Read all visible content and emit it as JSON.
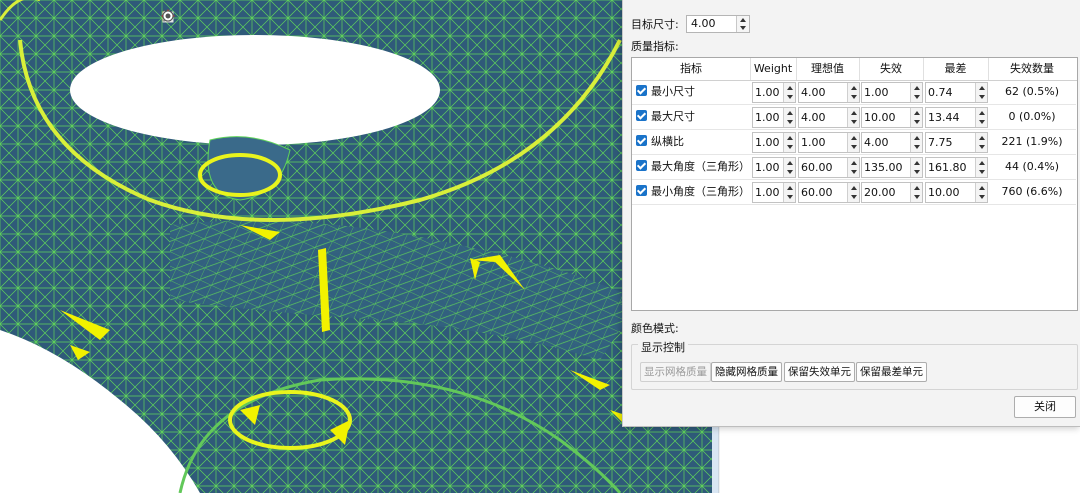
{
  "dialog": {
    "target_size_label": "目标尺寸:",
    "target_size_value": "4.00",
    "quality_label": "质量指标:",
    "color_mode_label": "颜色模式:",
    "display_control_label": "显示控制",
    "close_label": "关闭"
  },
  "table": {
    "headers": [
      "指标",
      "Weight",
      "理想值",
      "失效",
      "最差",
      "失效数量"
    ],
    "rows": [
      {
        "checked": true,
        "metric": "最小尺寸",
        "weight": "1.00",
        "ideal": "4.00",
        "fail": "1.00",
        "worst": "0.74",
        "fail_count": "62 (0.5%)"
      },
      {
        "checked": true,
        "metric": "最大尺寸",
        "weight": "1.00",
        "ideal": "4.00",
        "fail": "10.00",
        "worst": "13.44",
        "fail_count": "0 (0.0%)"
      },
      {
        "checked": true,
        "metric": "纵横比",
        "weight": "1.00",
        "ideal": "1.00",
        "fail": "4.00",
        "worst": "7.75",
        "fail_count": "221 (1.9%)"
      },
      {
        "checked": true,
        "metric": "最大角度（三角形）",
        "weight": "1.00",
        "ideal": "60.00",
        "fail": "135.00",
        "worst": "161.80",
        "fail_count": "44 (0.4%)"
      },
      {
        "checked": true,
        "metric": "最小角度（三角形）",
        "weight": "1.00",
        "ideal": "60.00",
        "fail": "20.00",
        "worst": "10.00",
        "fail_count": "760 (6.6%)"
      }
    ]
  },
  "buttons": {
    "show_quality": "显示网格质量",
    "hide_quality": "隐藏网格质量",
    "keep_failed": "保留失效单元",
    "keep_worst": "保留最差单元"
  },
  "toolbar": {
    "icons": [
      "view-xz-icon",
      "view-zx-icon",
      "view-yz-icon",
      "view-zy-icon",
      "view-xy-icon",
      "view-yx-icon",
      "select-arrow-icon",
      "shaded-icon",
      "wireframe-shaded-icon",
      "box-icon",
      "points-icon",
      "pick-node-icon",
      "pick-element-icon"
    ]
  },
  "colors": {
    "mesh_fill": "#2f5a79",
    "mesh_lines": "#5fd35a",
    "bad_elements": "#f2f200",
    "accent": "#1a73c9"
  }
}
